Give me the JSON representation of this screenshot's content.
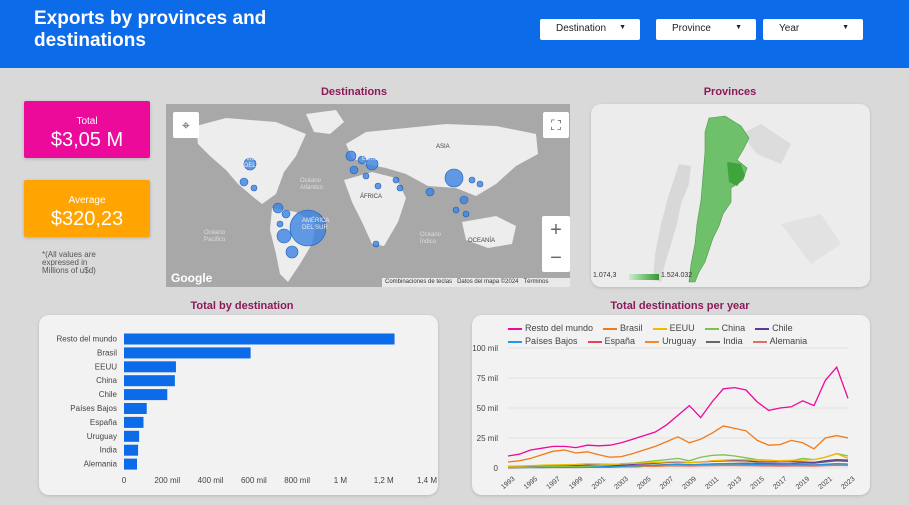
{
  "header": {
    "title": "Exports by provinces and destinations",
    "filters": [
      "Destination",
      "Province",
      "Year"
    ]
  },
  "kpis": {
    "total_label": "Total",
    "total_value": "$3,05 M",
    "average_label": "Average",
    "average_value": "$320,23",
    "note": "*(All values are expressed in Millions of u$d)"
  },
  "colors": {
    "header": "#0b6be8",
    "total_card": "#ec0a9b",
    "average_card": "#ffa400",
    "bar": "#0b6be8",
    "section_title": "#8b1a5a"
  },
  "destinations_map": {
    "title": "Destinations",
    "labels": [
      "AMÉRICA DEL NORTE",
      "Océano Atlántico",
      "EUROPA",
      "ASIA",
      "ÁFRICA",
      "AMÉRICA DEL SUR",
      "Océano Pacífico",
      "Océano Índico",
      "OCEANÍA"
    ],
    "attribution": [
      "Combinaciones de teclas",
      "Datos del mapa ©2024",
      "Términos"
    ],
    "google": "Google",
    "zoom_in": "+",
    "zoom_out": "−"
  },
  "provinces_map": {
    "title": "Provinces",
    "scale_min": "1.074,3",
    "scale_max": "1.524.032"
  },
  "chart_data": [
    {
      "type": "bar",
      "title": "Total by destination",
      "orientation": "horizontal",
      "categories": [
        "Resto del mundo",
        "Brasil",
        "EEUU",
        "China",
        "Chile",
        "Países Bajos",
        "España",
        "Uruguay",
        "India",
        "Alemania"
      ],
      "values": [
        1250000,
        585000,
        240000,
        235000,
        200000,
        105000,
        90000,
        70000,
        65000,
        60000
      ],
      "xticks": [
        "0",
        "200 mil",
        "400 mil",
        "600 mil",
        "800 mil",
        "1 M",
        "1,2 M",
        "1,4 M"
      ],
      "xlim": [
        0,
        1400000
      ]
    },
    {
      "type": "line",
      "title": "Total destinations per year",
      "x": [
        1993,
        1994,
        1995,
        1996,
        1997,
        1998,
        1999,
        2000,
        2001,
        2002,
        2003,
        2004,
        2005,
        2006,
        2007,
        2008,
        2009,
        2010,
        2011,
        2012,
        2013,
        2014,
        2015,
        2016,
        2017,
        2018,
        2019,
        2020,
        2021,
        2022,
        2023
      ],
      "xticks": [
        "1993",
        "1995",
        "1997",
        "1999",
        "2001",
        "2003",
        "2005",
        "2007",
        "2009",
        "2011",
        "2013",
        "2015",
        "2017",
        "2019",
        "2021",
        "2023"
      ],
      "yticks": [
        "0",
        "25 mil",
        "50 mil",
        "75 mil",
        "100 mil"
      ],
      "ylim": [
        0,
        100000
      ],
      "series": [
        {
          "name": "Resto del mundo",
          "color": "#ec0a9b",
          "values": [
            10000,
            11500,
            15000,
            16500,
            18000,
            18000,
            17000,
            19000,
            18500,
            19000,
            21000,
            24000,
            27000,
            30000,
            36000,
            44000,
            52000,
            42000,
            55000,
            66000,
            67000,
            65000,
            55000,
            48000,
            50000,
            51000,
            56000,
            52000,
            73000,
            84000,
            58000
          ]
        },
        {
          "name": "Brasil",
          "color": "#f07a1a",
          "values": [
            5000,
            6000,
            8000,
            11000,
            14000,
            15000,
            12500,
            13500,
            11000,
            9000,
            9500,
            12000,
            15000,
            18000,
            22000,
            26000,
            21000,
            24000,
            29000,
            35000,
            33000,
            31000,
            23000,
            19000,
            19500,
            23000,
            21000,
            16000,
            25000,
            27000,
            25000
          ]
        },
        {
          "name": "EEUU",
          "color": "#f5b800",
          "values": [
            1500,
            1700,
            2000,
            2300,
            2600,
            2800,
            3000,
            3500,
            3400,
            3200,
            3300,
            3800,
            4200,
            4600,
            5000,
            5500,
            4500,
            5000,
            6000,
            6500,
            7000,
            6800,
            6500,
            6300,
            6200,
            6400,
            6500,
            7000,
            9000,
            12000,
            8000
          ]
        },
        {
          "name": "China",
          "color": "#7cc24c",
          "values": [
            500,
            600,
            700,
            1000,
            1300,
            1500,
            1200,
            1500,
            2000,
            2500,
            3500,
            4000,
            5000,
            6000,
            7000,
            8000,
            6000,
            9000,
            10500,
            11000,
            10000,
            8500,
            7000,
            6500,
            5500,
            6000,
            8000,
            7000,
            9000,
            12000,
            10000
          ]
        },
        {
          "name": "Chile",
          "color": "#5b3a9e",
          "values": [
            1000,
            1200,
            1500,
            1800,
            2000,
            2200,
            2100,
            2300,
            2200,
            2000,
            2400,
            3000,
            3500,
            4000,
            4600,
            5200,
            4500,
            5000,
            5600,
            6000,
            6100,
            6000,
            5200,
            5000,
            5100,
            5300,
            5000,
            4700,
            6000,
            7000,
            6500
          ]
        },
        {
          "name": "Países Bajos",
          "color": "#1f9ae5",
          "values": [
            800,
            900,
            1000,
            1200,
            1300,
            1400,
            1300,
            1400,
            1300,
            1300,
            1500,
            1700,
            2000,
            2300,
            2600,
            3000,
            2600,
            2800,
            3200,
            3300,
            3300,
            3200,
            2800,
            2600,
            2500,
            2600,
            2700,
            2500,
            3000,
            3500,
            3200
          ]
        },
        {
          "name": "España",
          "color": "#e8425a",
          "values": [
            900,
            1000,
            1100,
            1200,
            1400,
            1500,
            1400,
            1500,
            1400,
            1400,
            1600,
            1900,
            2200,
            2500,
            2900,
            3300,
            2800,
            3000,
            3400,
            3500,
            3400,
            3300,
            2900,
            2700,
            2600,
            2700,
            2800,
            2600,
            3100,
            3600,
            3300
          ]
        },
        {
          "name": "Uruguay",
          "color": "#f08a30",
          "values": [
            600,
            700,
            800,
            900,
            1000,
            1100,
            1000,
            1050,
            900,
            800,
            900,
            1100,
            1300,
            1500,
            1800,
            2100,
            1900,
            2200,
            2500,
            2700,
            2800,
            2700,
            2400,
            2200,
            2100,
            2200,
            2300,
            2000,
            2600,
            3000,
            2700
          ]
        },
        {
          "name": "India",
          "color": "#666666",
          "values": [
            200,
            250,
            300,
            350,
            400,
            450,
            450,
            500,
            550,
            600,
            800,
            1000,
            1300,
            1600,
            2000,
            2500,
            2600,
            3000,
            3300,
            3600,
            3800,
            4000,
            3800,
            3600,
            3500,
            3700,
            4200,
            4000,
            5000,
            6000,
            5500
          ]
        },
        {
          "name": "Alemania",
          "color": "#e56a6a",
          "values": [
            700,
            750,
            800,
            900,
            1000,
            1050,
            1000,
            1050,
            950,
            900,
            1000,
            1150,
            1300,
            1450,
            1650,
            1850,
            1600,
            1750,
            1950,
            2000,
            2000,
            1950,
            1750,
            1650,
            1600,
            1650,
            1700,
            1600,
            1900,
            2200,
            2000
          ]
        }
      ]
    }
  ]
}
